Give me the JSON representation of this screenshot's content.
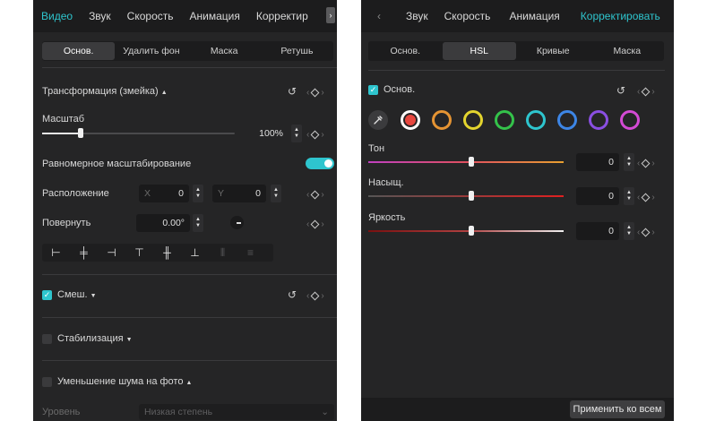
{
  "left": {
    "tabs": [
      "Видео",
      "Звук",
      "Скорость",
      "Анимация",
      "Корректир"
    ],
    "tab_next": "›",
    "subtabs": [
      "Основ.",
      "Удалить фон",
      "Маска",
      "Ретушь"
    ],
    "transform_title": "Трансформация (змейка)",
    "scale_label": "Масштаб",
    "scale_value": "100%",
    "scale_level": 0.2,
    "uniform_label": "Равномерное масштабирование",
    "position_label": "Расположение",
    "pos_x_prefix": "X",
    "pos_x_value": "0",
    "pos_y_prefix": "Y",
    "pos_y_value": "0",
    "rotate_label": "Повернуть",
    "rotate_value": "0.00°",
    "blend_label": "Смеш.",
    "stab_label": "Стабилизация",
    "denoise_label": "Уменьшение шума на фото",
    "level_label": "Уровень",
    "level_value": "Низкая степень"
  },
  "right": {
    "tab_prev": "‹",
    "tabs": [
      "Звук",
      "Скорость",
      "Анимация",
      "Корректировать"
    ],
    "subtabs": [
      "Основ.",
      "HSL",
      "Кривые",
      "Маска"
    ],
    "basic_label": "Основ.",
    "hue_label": "Тон",
    "hue_value": "0",
    "sat_label": "Насыщ.",
    "sat_value": "0",
    "light_label": "Яркость",
    "light_value": "0",
    "swatch_colors": [
      "#e8473f",
      "#e59433",
      "#e3d42e",
      "#34c24a",
      "#2ec5ce",
      "#3d86e6",
      "#8a4fe2",
      "#d44ad4"
    ],
    "apply_label": "Применить ко всем"
  },
  "accent": "#2ec5ce"
}
